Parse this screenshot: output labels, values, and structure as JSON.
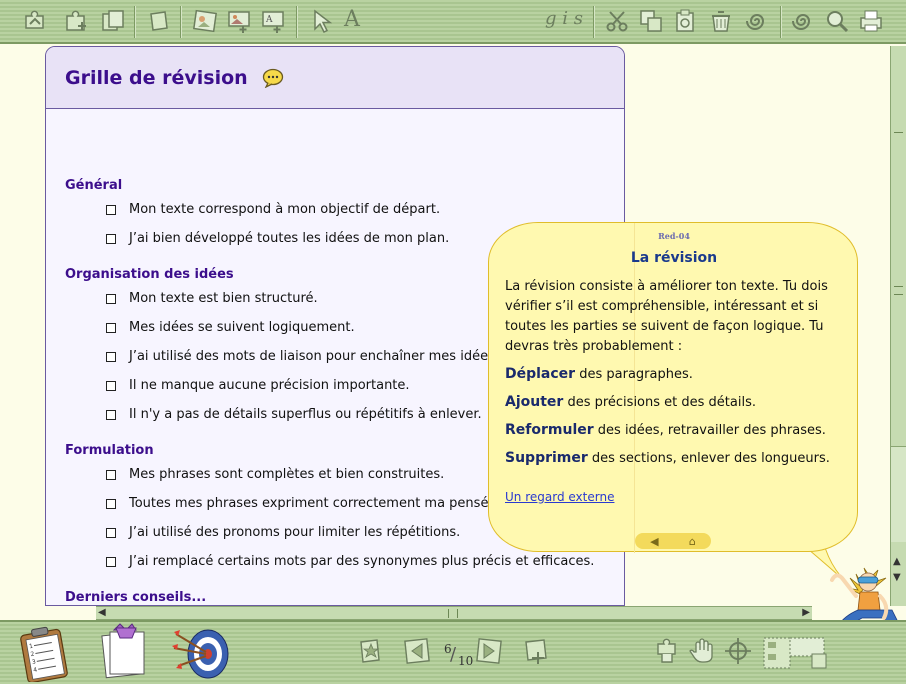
{
  "toolbar_top": {
    "format_label": "g i s",
    "text_tool_label": "A",
    "icons": [
      "puzzle-arrow-icon",
      "puzzle-add-icon",
      "puzzle-pages-icon",
      "blank-page-icon",
      "image-edit-icon",
      "picture-insert-icon",
      "text-box-insert-icon",
      "pointer-icon",
      "text-tool-icon",
      "cut-icon",
      "copy-icon",
      "paste-icon",
      "trash-icon",
      "spiral-icon",
      "spiral-help-icon",
      "magnifier-icon",
      "printer-icon"
    ]
  },
  "card": {
    "title": "Grille de révision",
    "sections": [
      {
        "title": "Général",
        "items": [
          "Mon texte correspond à mon objectif de départ.",
          "J’ai bien développé toutes les idées de mon plan."
        ]
      },
      {
        "title": "Organisation des idées",
        "items": [
          "Mon texte est bien structuré.",
          "Mes idées se suivent logiquement.",
          "J’ai utilisé des mots de liaison pour enchaîner mes idées.",
          "Il ne manque aucune précision importante.",
          "Il n'y a pas de détails superflus ou répétitifs à enlever."
        ]
      },
      {
        "title": "Formulation",
        "items": [
          "Mes phrases sont complètes et bien construites.",
          "Toutes mes phrases expriment correctement ma pensée.",
          "J’ai utilisé des pronoms pour limiter les répétitions.",
          "J’ai remplacé certains mots par des synonymes plus précis et efficaces."
        ]
      },
      {
        "title": "Derniers conseils...",
        "items": []
      }
    ]
  },
  "bubble": {
    "code": "Red-04",
    "title": "La révision",
    "intro": "La révision consiste à améliorer ton texte. Tu dois vérifier s’il est compréhensible, intéressant et si toutes les parties se suivent de façon logique. Tu devras très probablement :",
    "actions": [
      {
        "verb": "Déplacer",
        "rest": " des paragraphes."
      },
      {
        "verb": "Ajouter",
        "rest": " des précisions et des détails."
      },
      {
        "verb": "Reformuler",
        "rest": " des idées, retravailler des phrases."
      },
      {
        "verb": "Supprimer",
        "rest": " des sections, enlever des longueurs."
      }
    ],
    "link": "Un regard externe",
    "nav_prev": "◀",
    "nav_home": "⌂"
  },
  "toolbar_bottom": {
    "page_current": "6",
    "page_total": "10",
    "icons": [
      "checklist-clipboard-icon",
      "notes-pages-icon",
      "target-arrows-icon",
      "star-page-icon",
      "page-back-icon",
      "page-forward-icon",
      "page-add-icon",
      "puzzle-hand-icon",
      "hand-icon",
      "crosshair-icon",
      "layout-grid-icon"
    ]
  },
  "colors": {
    "toolbar_green": "#b9d2a1",
    "card_title_purple": "#3c0e8c",
    "bubble_yellow": "#fff9b0",
    "link_blue": "#2a3ad0"
  }
}
